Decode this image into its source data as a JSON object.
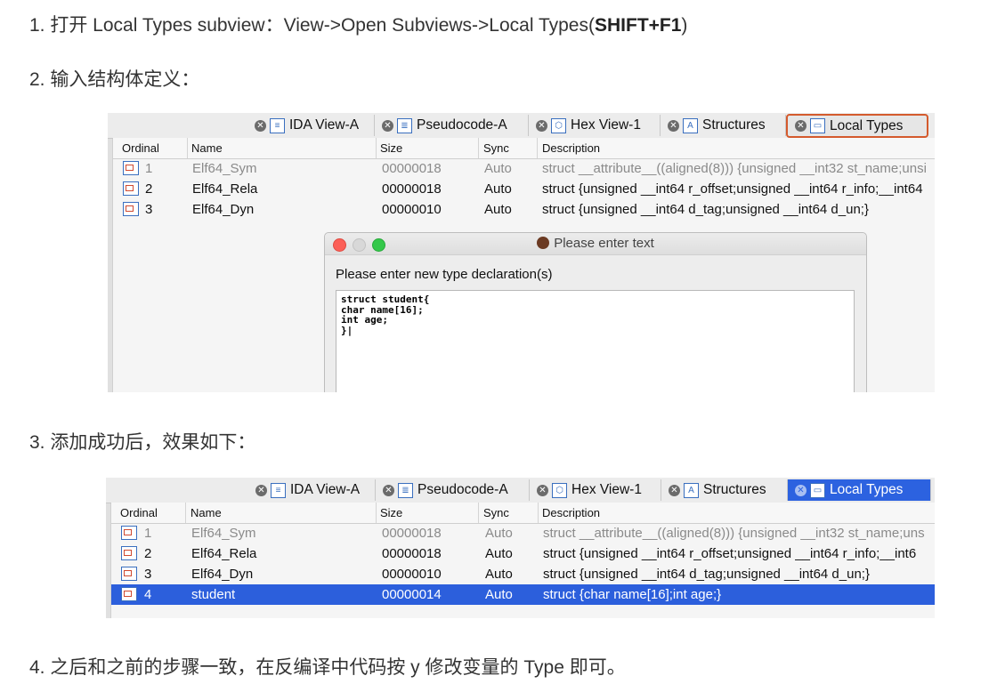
{
  "steps": {
    "s1_prefix": "1. 打开 Local Types subview：View->Open Subviews->Local Types(",
    "s1_shortcut": "SHIFT+F1",
    "s1_suffix": ")",
    "s2": "2. 输入结构体定义：",
    "s3": "3. 添加成功后，效果如下：",
    "s4": "4. 之后和之前的步骤一致，在反编译中代码按 y 修改变量的 Type 即可。"
  },
  "tabs": [
    "IDA View-A",
    "Pseudocode-A",
    "Hex View-1",
    "Structures",
    "Local Types"
  ],
  "tab_icons": [
    "list-doc-icon",
    "pseudocode-icon",
    "hex-icon",
    "structures-icon",
    "local-types-icon"
  ],
  "columns": {
    "ordinal": "Ordinal",
    "name": "Name",
    "size": "Size",
    "sync": "Sync",
    "description": "Description"
  },
  "rows_before": [
    {
      "ordinal": "1",
      "name": "Elf64_Sym",
      "size": "00000018",
      "sync": "Auto",
      "description": "struct __attribute__((aligned(8))) {unsigned __int32 st_name;unsi"
    },
    {
      "ordinal": "2",
      "name": "Elf64_Rela",
      "size": "00000018",
      "sync": "Auto",
      "description": "struct {unsigned __int64 r_offset;unsigned __int64 r_info;__int64"
    },
    {
      "ordinal": "3",
      "name": "Elf64_Dyn",
      "size": "00000010",
      "sync": "Auto",
      "description": "struct {unsigned __int64 d_tag;unsigned __int64 d_un;}"
    }
  ],
  "rows_after": [
    {
      "ordinal": "1",
      "name": "Elf64_Sym",
      "size": "00000018",
      "sync": "Auto",
      "description": "struct __attribute__((aligned(8))) {unsigned __int32 st_name;uns"
    },
    {
      "ordinal": "2",
      "name": "Elf64_Rela",
      "size": "00000018",
      "sync": "Auto",
      "description": "struct {unsigned __int64 r_offset;unsigned __int64 r_info;__int6"
    },
    {
      "ordinal": "3",
      "name": "Elf64_Dyn",
      "size": "00000010",
      "sync": "Auto",
      "description": "struct {unsigned __int64 d_tag;unsigned __int64 d_un;}"
    },
    {
      "ordinal": "4",
      "name": "student",
      "size": "00000014",
      "sync": "Auto",
      "description": "struct {char name[16];int age;}"
    }
  ],
  "dialog": {
    "title": "Please enter text",
    "prompt": "Please enter new type declaration(s)",
    "text": "struct student{\nchar name[16];\nint age;\n}|"
  },
  "colors": {
    "highlight_border": "#d45a2d",
    "selection": "#2c5fdc",
    "active_tab": "#2c62e0"
  }
}
